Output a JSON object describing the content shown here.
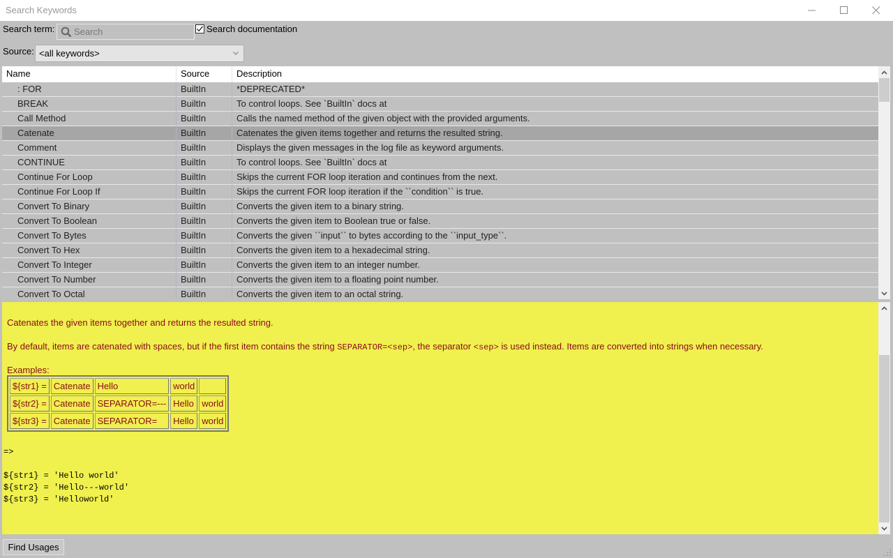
{
  "window": {
    "title": "Search Keywords",
    "controls": [
      "minimize",
      "maximize",
      "close"
    ]
  },
  "search": {
    "label": "Search term:",
    "placeholder": "Search",
    "value": "",
    "search_docs_label": "Search documentation",
    "search_docs_checked": true
  },
  "source": {
    "label": "Source:",
    "selected": "<all keywords>"
  },
  "table": {
    "columns": [
      "Name",
      "Source",
      "Description"
    ],
    "selected_index": 3,
    "rows": [
      {
        "name": ": FOR",
        "source": "BuiltIn",
        "description": "*DEPRECATED*"
      },
      {
        "name": "BREAK",
        "source": "BuiltIn",
        "description": "To control loops. See `BuiltIn` docs at"
      },
      {
        "name": "Call Method",
        "source": "BuiltIn",
        "description": "Calls the named method of the given object with the provided arguments."
      },
      {
        "name": "Catenate",
        "source": "BuiltIn",
        "description": "Catenates the given items together and returns the resulted string."
      },
      {
        "name": "Comment",
        "source": "BuiltIn",
        "description": "Displays the given messages in the log file as keyword arguments."
      },
      {
        "name": "CONTINUE",
        "source": "BuiltIn",
        "description": "To control loops. See `BuiltIn` docs at"
      },
      {
        "name": "Continue For Loop",
        "source": "BuiltIn",
        "description": "Skips the current FOR loop iteration and continues from the next."
      },
      {
        "name": "Continue For Loop If",
        "source": "BuiltIn",
        "description": "Skips the current FOR loop iteration if the ``condition`` is true."
      },
      {
        "name": "Convert To Binary",
        "source": "BuiltIn",
        "description": "Converts the given item to a binary string."
      },
      {
        "name": "Convert To Boolean",
        "source": "BuiltIn",
        "description": "Converts the given item to Boolean true or false."
      },
      {
        "name": "Convert To Bytes",
        "source": "BuiltIn",
        "description": "Converts the given ``input`` to bytes according to the ``input_type``."
      },
      {
        "name": "Convert To Hex",
        "source": "BuiltIn",
        "description": "Converts the given item to a hexadecimal string."
      },
      {
        "name": "Convert To Integer",
        "source": "BuiltIn",
        "description": "Converts the given item to an integer number."
      },
      {
        "name": "Convert To Number",
        "source": "BuiltIn",
        "description": "Converts the given item to a floating point number."
      },
      {
        "name": "Convert To Octal",
        "source": "BuiltIn",
        "description": "Converts the given item to an octal string."
      }
    ]
  },
  "doc": {
    "summary": "Catenates the given items together and returns the resulted string.",
    "para_before": "By default, items are catenated with spaces, but if the first item contains the string ",
    "para_code1": "SEPARATOR=<sep>",
    "para_mid": ", the separator ",
    "para_code2": "<sep>",
    "para_after": " is used instead. Items are converted into strings when necessary.",
    "examples_label": "Examples:",
    "examples": [
      [
        "${str1} =",
        "Catenate",
        "Hello",
        "world",
        ""
      ],
      [
        "${str2} =",
        "Catenate",
        "SEPARATOR=---",
        "Hello",
        "world"
      ],
      [
        "${str3} =",
        "Catenate",
        "SEPARATOR=",
        "Hello",
        "world"
      ]
    ],
    "arrow": "=>",
    "results": [
      "${str1} = 'Hello world'",
      "${str2} = 'Hello---world'",
      "${str3} = 'Helloworld'"
    ]
  },
  "buttons": {
    "find_usages": "Find Usages"
  }
}
